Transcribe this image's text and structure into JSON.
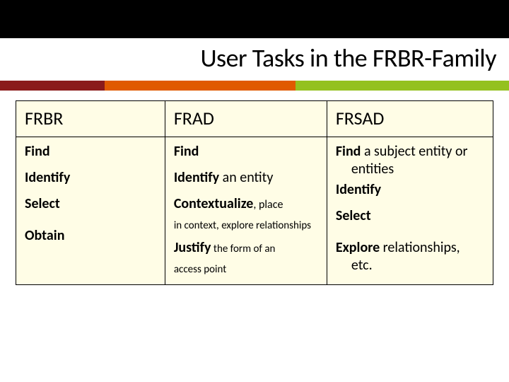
{
  "title": "User Tasks in the FRBR-Family",
  "headers": {
    "c1": "FRBR",
    "c2": "FRAD",
    "c3": "FRSAD"
  },
  "c1": {
    "r1": "Find",
    "r2": "Identify",
    "r3": "Select",
    "r4": "Obtain"
  },
  "c2": {
    "r1": "Find",
    "r2b": "Identify",
    "r2rest": " an entity",
    "r3b": "Contextualize",
    "r3rest": ", place",
    "r3sub": "in context, explore relationships",
    "r4b": "Justify",
    "r4rest": " the form of an",
    "r4sub": "access point"
  },
  "c3": {
    "r1b": "Find",
    "r1rest": " a subject entity or",
    "r1sub": "entities",
    "r2": "Identify",
    "r3": "Select",
    "r4b": "Explore",
    "r4rest": " relationships,",
    "r4sub": "etc."
  }
}
